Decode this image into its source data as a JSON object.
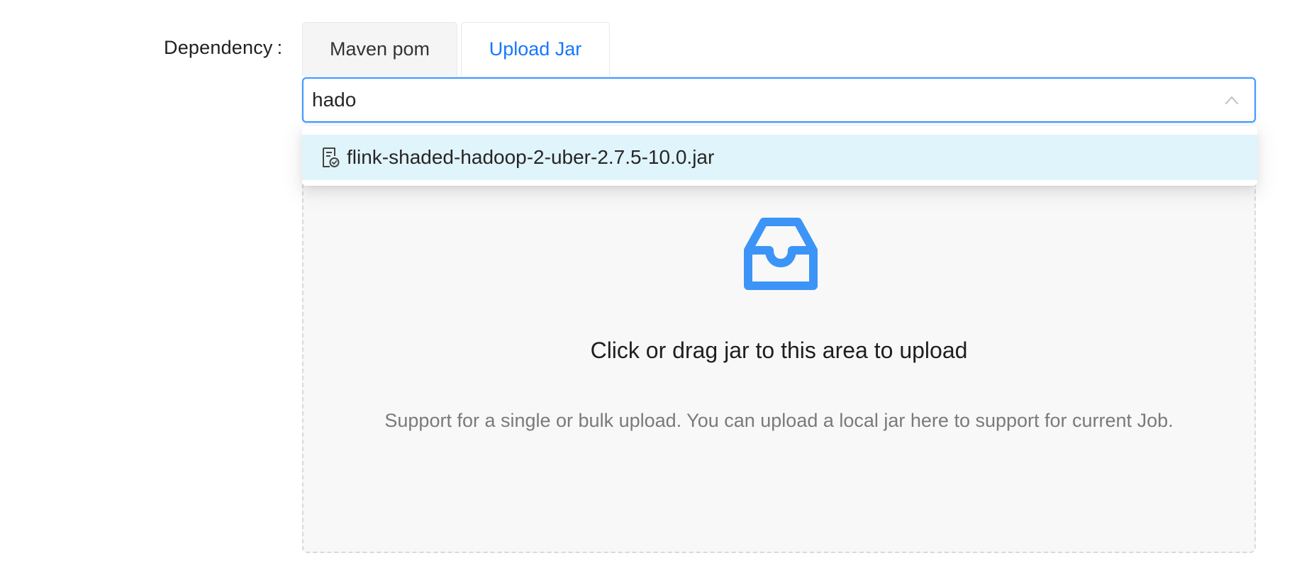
{
  "form": {
    "label": "Dependency",
    "colon": ":"
  },
  "tabs": [
    {
      "label": "Maven pom",
      "active": false
    },
    {
      "label": "Upload Jar",
      "active": true
    }
  ],
  "select": {
    "value": "hado",
    "chevron_icon": "chevron-up-icon",
    "options": [
      {
        "label": "flink-shaded-hadoop-2-uber-2.7.5-10.0.jar",
        "icon": "file-done-icon",
        "highlighted": true
      }
    ]
  },
  "upload": {
    "icon": "inbox-icon",
    "title": "Click or drag jar to this area to upload",
    "hint": "Support for a single or bulk upload. You can upload a local jar here to support for current Job."
  },
  "colors": {
    "accent": "#1677ff",
    "focus_border": "#4096ff",
    "option_highlight": "#e0f4fb",
    "upload_icon": "#3c94f7"
  }
}
